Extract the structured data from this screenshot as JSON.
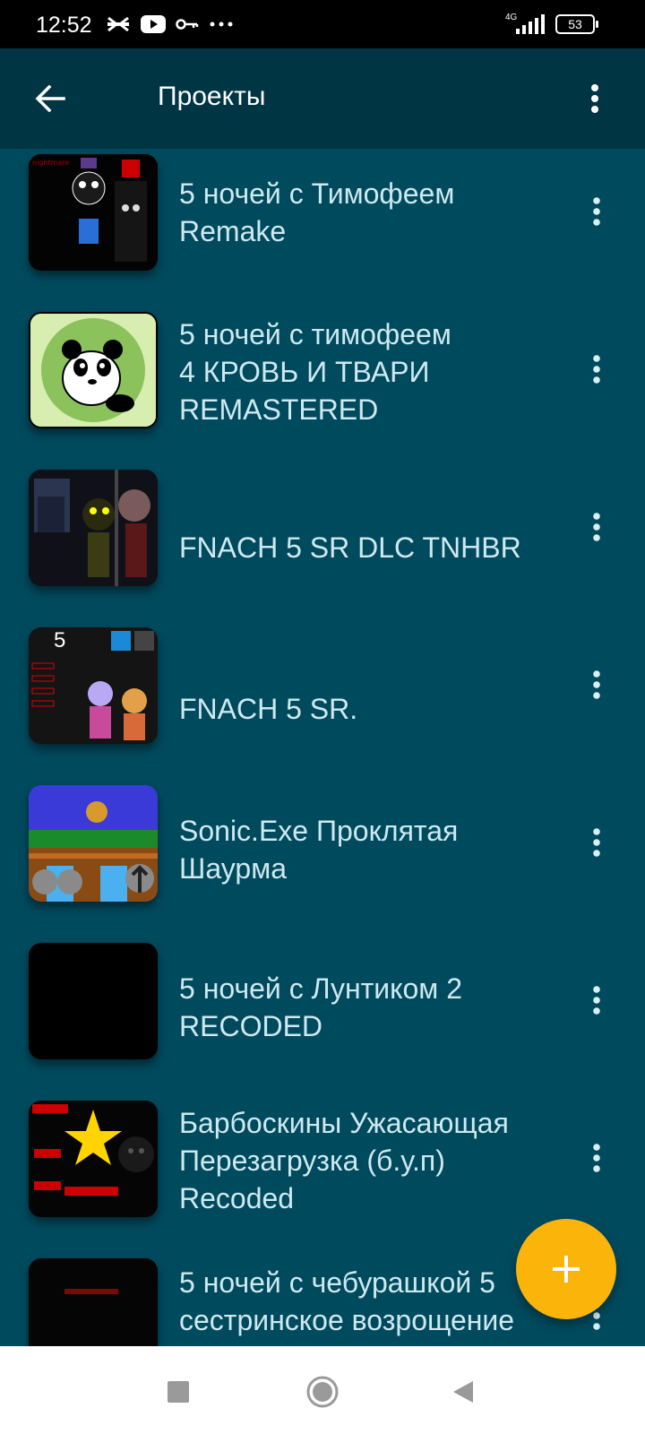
{
  "status_bar": {
    "time": "12:52",
    "network": "4G",
    "battery": "53",
    "icons": [
      "capcut-icon",
      "youtube-icon",
      "key-icon",
      "more-notifications-icon"
    ]
  },
  "app_bar": {
    "title": "Проекты",
    "back_icon": "arrow-left-icon",
    "menu_icon": "more-vertical-icon",
    "background": "#003544"
  },
  "projects": [
    {
      "title": "5 ночей с Тимофеем\nRemake",
      "thumbnail": "dark-characters-thumbnail"
    },
    {
      "title": "5 ночей с тимофеем\n4 КРОВЬ И ТВАРИ\nREMASTERED",
      "thumbnail": "panda-thumbnail"
    },
    {
      "title": "FNACH 5 SR DLC TNHBR",
      "thumbnail": "animatronics-office-thumbnail"
    },
    {
      "title": "FNACH 5 SR.",
      "thumbnail": "fnach-menu-thumbnail"
    },
    {
      "title": "Sonic.Exe Проклятая\nШаурма",
      "thumbnail": "sonic-level-thumbnail"
    },
    {
      "title": "5 ночей с Лунтиком 2\nRECODED",
      "thumbnail": "black-thumbnail"
    },
    {
      "title": "Барбоскины Ужасающая\nПерезагрузка (б.у.п)\nRecoded",
      "thumbnail": "star-menu-thumbnail"
    },
    {
      "title": "5 ночей с чебурашкой 5\nсестринское возрощение",
      "thumbnail": "dark-red-thumbnail"
    }
  ],
  "fab": {
    "icon": "plus-icon",
    "color": "#fbb40a"
  },
  "nav_bar": {
    "buttons": [
      "recents-square-icon",
      "home-circle-icon",
      "back-triangle-icon"
    ]
  },
  "colors": {
    "background": "#004a5e",
    "text": "#cfe9f0",
    "accent": "#fbb40a"
  }
}
